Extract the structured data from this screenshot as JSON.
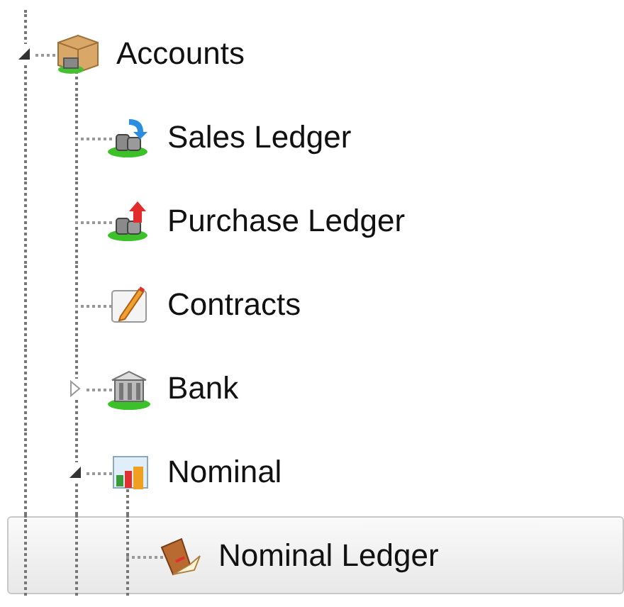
{
  "tree": [
    {
      "label": "Accounts",
      "expanded": true,
      "selected": false,
      "children": [
        {
          "label": "Sales Ledger",
          "selected": false
        },
        {
          "label": "Purchase Ledger",
          "selected": false
        },
        {
          "label": "Contracts",
          "selected": false
        },
        {
          "label": "Bank",
          "expanded": false,
          "selected": false
        },
        {
          "label": "Nominal",
          "expanded": true,
          "selected": false,
          "children": [
            {
              "label": "Nominal Ledger",
              "selected": true
            }
          ]
        }
      ]
    }
  ]
}
